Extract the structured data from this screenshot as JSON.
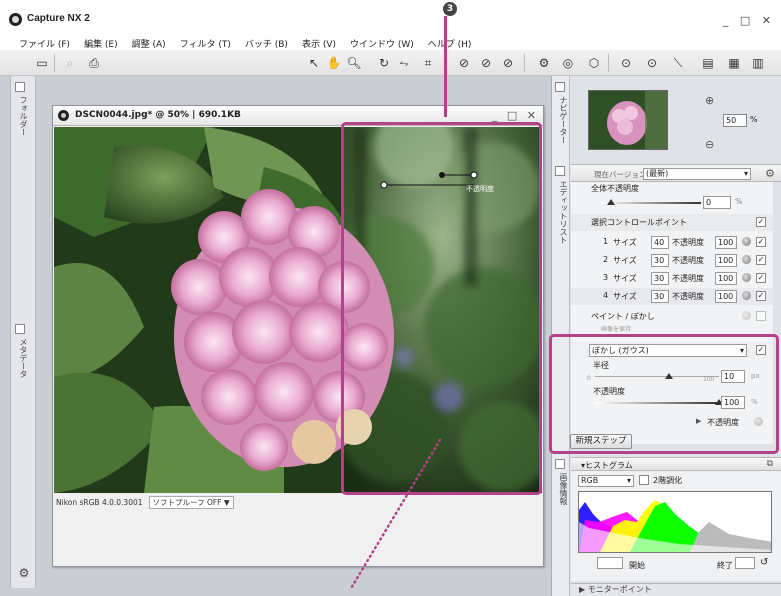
{
  "app": {
    "title": "Capture NX 2",
    "window_controls": "_ □ ✕",
    "callout_number": "3"
  },
  "menu": [
    "ファイル (F)",
    "編集 (E)",
    "調整 (A)",
    "フィルタ (T)",
    "バッチ (B)",
    "表示 (V)",
    "ウインドウ (W)",
    "ヘルプ (H)"
  ],
  "left_palette_tabs": [
    "フォルダー",
    "メタデータ"
  ],
  "image_window": {
    "title": "DSCN0044.jpg* @ 50% | 690.1KB",
    "controls": "_ □ ✕",
    "color_profile": "Nikon sRGB 4.0.0.3001",
    "soft_proof": "ソフトプルーフ OFF  ▼"
  },
  "right_palette_tabs": [
    "ナビゲーター",
    "エディットリスト",
    "画像情報"
  ],
  "navigator": {
    "zoom_value": "50",
    "zoom_unit": "%"
  },
  "edit_list": {
    "version_label": "現在バージョン",
    "version_value": "(最新)",
    "opacity_row_label": "全体不透明度",
    "opacity_value": "0",
    "opacity_unit": "%",
    "control_points_label": "選択コントロールポイント",
    "points": [
      {
        "index": "1",
        "size_label": "サイズ",
        "size": "40",
        "opacity_label": "不透明度",
        "opacity": "100"
      },
      {
        "index": "2",
        "size_label": "サイズ",
        "size": "30",
        "opacity_label": "不透明度",
        "opacity": "100"
      },
      {
        "index": "3",
        "size_label": "サイズ",
        "size": "30",
        "opacity_label": "不透明度",
        "opacity": "100"
      },
      {
        "index": "4",
        "size_label": "サイズ",
        "size": "30",
        "opacity_label": "不透明度",
        "opacity": "100"
      }
    ],
    "paint_label": "ペイント / ぼかし",
    "paint_sub_label": "画像を保持",
    "blur": {
      "filter_label": "ぼかし (ガウス)",
      "radius_label": "半径",
      "radius_min": "0",
      "radius_max": "100",
      "radius_value": "10",
      "radius_unit": "px",
      "opacity_label": "不透明度",
      "opacity_value": "100",
      "opacity_unit": "%",
      "blend_label": "不透明度",
      "radius_fraction": 0.1,
      "opacity_fraction": 1.0
    },
    "new_step_label": "新規ステップ"
  },
  "histogram": {
    "title": "ヒストグラム",
    "channel": "RGB",
    "two_point_label": "2階調化",
    "start_label": "開始",
    "end_label": "終了"
  },
  "monitor_point": {
    "title": "モニターポイント"
  },
  "photo_overlay": {
    "control_label": "不透明度"
  }
}
